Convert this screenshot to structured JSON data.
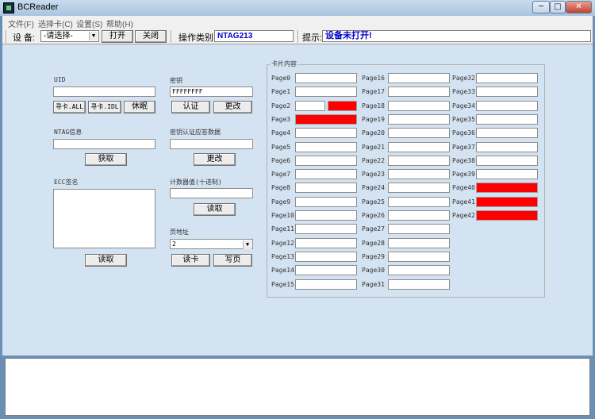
{
  "window": {
    "title": "BCReader",
    "minimize": "─",
    "maximize": "□",
    "close": "✕"
  },
  "menu": [
    "文件(F)",
    "选择卡(C)",
    "设置(S)",
    "帮助(H)"
  ],
  "toolbar": {
    "device_label": "设  备:",
    "device_value": "-请选择-",
    "open_label": "打开",
    "close_label": "关闭",
    "optype_label": "操作类别:",
    "optype_value": "NTAG213",
    "hint_label": "提示:",
    "hint_value": "设备未打开!",
    "hint_color": "#0000cc",
    "optype_color": "#0000cc"
  },
  "left": {
    "uid_label": "UID",
    "uid_value": "",
    "find_all": "寻卡.ALL",
    "find_idl": "寻卡.IDL",
    "sleep": "休眠",
    "ntag_label": "NTAG信息",
    "ntag_value": "",
    "get_button": "获取",
    "ecc_label": "ECC签名",
    "ecc_value": "",
    "read_button": "读取"
  },
  "middle": {
    "key_label": "密钥",
    "key_value": "FFFFFFFF",
    "auth_button": "认证",
    "change_button": "更改",
    "auth_resp_label": "密钥认证应答数据",
    "auth_resp_value": "",
    "auth_resp_change": "更改",
    "counter_label": "计数器值(十进制)",
    "counter_value": "",
    "counter_read": "读取",
    "page_addr_label": "页地址",
    "page_addr_value": "2",
    "read_card": "读卡",
    "write_page": "写页"
  },
  "card": {
    "title": "卡片内容",
    "pages": [
      {
        "label": "Page0",
        "value": "",
        "state": "normal"
      },
      {
        "label": "Page1",
        "value": "",
        "state": "normal"
      },
      {
        "label": "Page2",
        "value": "",
        "state": "split"
      },
      {
        "label": "Page3",
        "value": "",
        "state": "red"
      },
      {
        "label": "Page4",
        "value": "",
        "state": "normal"
      },
      {
        "label": "Page5",
        "value": "",
        "state": "normal"
      },
      {
        "label": "Page6",
        "value": "",
        "state": "normal"
      },
      {
        "label": "Page7",
        "value": "",
        "state": "normal"
      },
      {
        "label": "Page8",
        "value": "",
        "state": "normal"
      },
      {
        "label": "Page9",
        "value": "",
        "state": "normal"
      },
      {
        "label": "Page10",
        "value": "",
        "state": "normal"
      },
      {
        "label": "Page11",
        "value": "",
        "state": "normal"
      },
      {
        "label": "Page12",
        "value": "",
        "state": "normal"
      },
      {
        "label": "Page13",
        "value": "",
        "state": "normal"
      },
      {
        "label": "Page14",
        "value": "",
        "state": "normal"
      },
      {
        "label": "Page15",
        "value": "",
        "state": "normal"
      },
      {
        "label": "Page16",
        "value": "",
        "state": "normal"
      },
      {
        "label": "Page17",
        "value": "",
        "state": "normal"
      },
      {
        "label": "Page18",
        "value": "",
        "state": "normal"
      },
      {
        "label": "Page19",
        "value": "",
        "state": "normal"
      },
      {
        "label": "Page20",
        "value": "",
        "state": "normal"
      },
      {
        "label": "Page21",
        "value": "",
        "state": "normal"
      },
      {
        "label": "Page22",
        "value": "",
        "state": "normal"
      },
      {
        "label": "Page23",
        "value": "",
        "state": "normal"
      },
      {
        "label": "Page24",
        "value": "",
        "state": "normal"
      },
      {
        "label": "Page25",
        "value": "",
        "state": "normal"
      },
      {
        "label": "Page26",
        "value": "",
        "state": "normal"
      },
      {
        "label": "Page27",
        "value": "",
        "state": "normal"
      },
      {
        "label": "Page28",
        "value": "",
        "state": "normal"
      },
      {
        "label": "Page29",
        "value": "",
        "state": "normal"
      },
      {
        "label": "Page30",
        "value": "",
        "state": "normal"
      },
      {
        "label": "Page31",
        "value": "",
        "state": "normal"
      },
      {
        "label": "Page32",
        "value": "",
        "state": "normal"
      },
      {
        "label": "Page33",
        "value": "",
        "state": "normal"
      },
      {
        "label": "Page34",
        "value": "",
        "state": "normal"
      },
      {
        "label": "Page35",
        "value": "",
        "state": "normal"
      },
      {
        "label": "Page36",
        "value": "",
        "state": "normal"
      },
      {
        "label": "Page37",
        "value": "",
        "state": "normal"
      },
      {
        "label": "Page38",
        "value": "",
        "state": "normal"
      },
      {
        "label": "Page39",
        "value": "",
        "state": "normal"
      },
      {
        "label": "Page40",
        "value": "",
        "state": "red"
      },
      {
        "label": "Page41",
        "value": "",
        "state": "red"
      },
      {
        "label": "Page42",
        "value": "",
        "state": "red"
      }
    ]
  },
  "log": {
    "value": ""
  }
}
